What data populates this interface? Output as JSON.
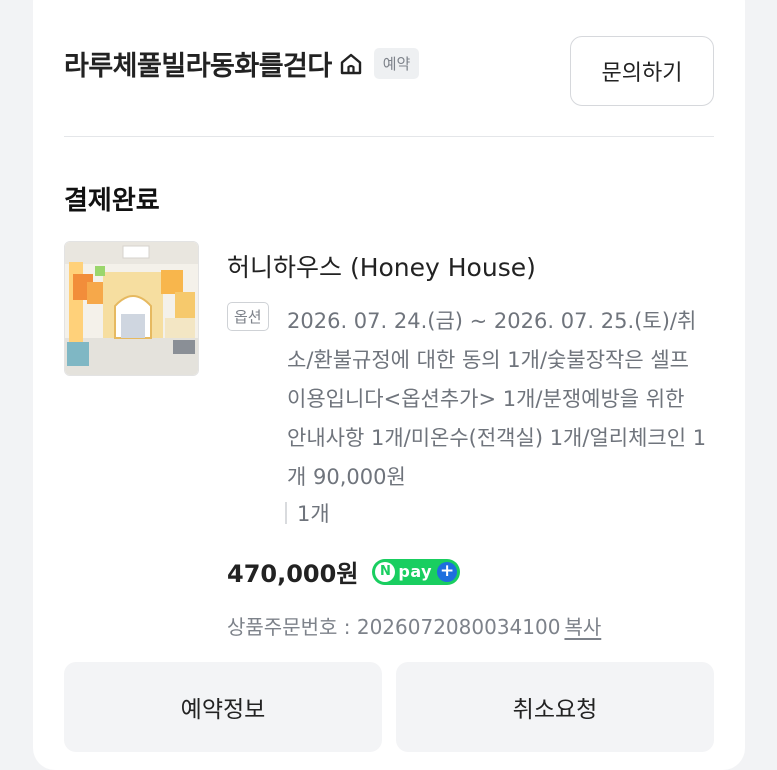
{
  "header": {
    "shop_name": "라루체풀빌라동화를걷다",
    "badge": "예약",
    "inquiry_label": "문의하기"
  },
  "order": {
    "status": "결제완료",
    "product_name": "허니하우스 (Honey House)",
    "option_badge": "옵션",
    "option_text": "2026. 07. 24.(금) ~ 2026. 07. 25.(토)/취소/환불규정에 대한 동의 1개/숯불장작은 셀프 이용입니다<옵션추가> 1개/분쟁예방을 위한 안내사항 1개/미온수(전객실) 1개/얼리체크인 1개 90,000원",
    "quantity": "1개",
    "price": "470,000원",
    "npay": {
      "n": "N",
      "pay": "pay",
      "plus": "+"
    },
    "order_number_label": "상품주문번호 : ",
    "order_number": "2026072080034100",
    "copy_label": "복사"
  },
  "actions": {
    "reservation_info": "예약정보",
    "cancel_request": "취소요청"
  },
  "icons": {
    "home": "home-icon",
    "thumbnail": "room-photo"
  },
  "colors": {
    "npay_green": "#19ce60",
    "npay_blue": "#1e6fde",
    "button_bg": "#f3f4f6"
  }
}
